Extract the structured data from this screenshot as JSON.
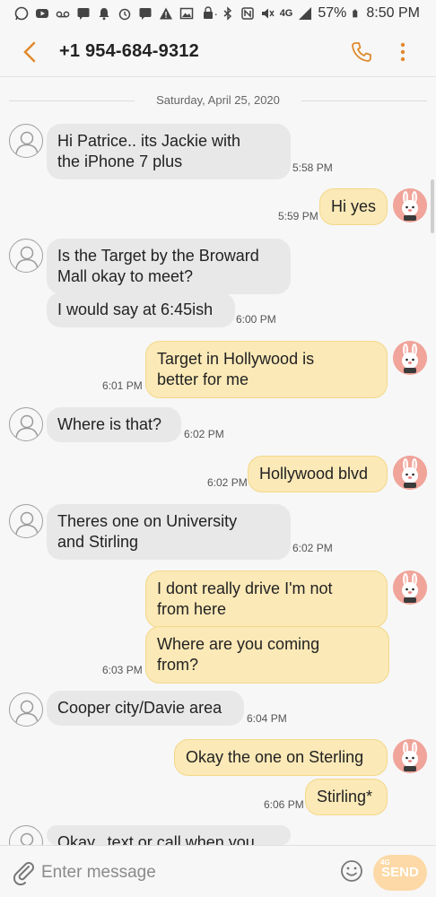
{
  "status_bar": {
    "battery": "57%",
    "time": "8:50 PM",
    "network": "4G",
    "more": "···"
  },
  "header": {
    "title": "+1 954-684-9312"
  },
  "date_divider": "Saturday, April 25, 2020",
  "messages": [
    {
      "dir": "in",
      "lines": [
        "Hi Patrice.. its Jackie with",
        "the iPhone 7 plus"
      ],
      "time": "5:58 PM"
    },
    {
      "dir": "out",
      "lines": [
        "Hi yes"
      ],
      "time": "5:59 PM"
    },
    {
      "dir": "in",
      "lines": [
        "Is the Target by the Broward",
        "Mall okay to meet?"
      ],
      "time": ""
    },
    {
      "dir": "in",
      "lines": [
        "I would say at 6:45ish"
      ],
      "time": "6:00 PM"
    },
    {
      "dir": "out",
      "lines": [
        "Target in Hollywood is",
        "better for me"
      ],
      "time": "6:01 PM"
    },
    {
      "dir": "in",
      "lines": [
        "Where is that?"
      ],
      "time": "6:02 PM"
    },
    {
      "dir": "out",
      "lines": [
        "Hollywood blvd"
      ],
      "time": "6:02 PM"
    },
    {
      "dir": "in",
      "lines": [
        "Theres one on University",
        "and Stirling"
      ],
      "time": "6:02 PM"
    },
    {
      "dir": "out",
      "lines": [
        "I dont really drive I'm not",
        "from here"
      ],
      "time": ""
    },
    {
      "dir": "out",
      "lines": [
        "Where are you coming",
        "from?"
      ],
      "time": "6:03 PM"
    },
    {
      "dir": "in",
      "lines": [
        "Cooper city/Davie area"
      ],
      "time": "6:04 PM"
    },
    {
      "dir": "out",
      "lines": [
        "Okay the one on Sterling"
      ],
      "time": ""
    },
    {
      "dir": "out",
      "lines": [
        "Stirling*"
      ],
      "time": "6:06 PM"
    },
    {
      "dir": "in",
      "lines": [
        "Okay...text or call when you"
      ],
      "time": ""
    }
  ],
  "input": {
    "placeholder": "Enter message",
    "send_label": "SEND",
    "send_small": "4G"
  },
  "colors": {
    "incoming_bubble": "#e8e8e8",
    "outgoing_bubble": "#fbe9b7",
    "accent": "#e08a2c"
  }
}
